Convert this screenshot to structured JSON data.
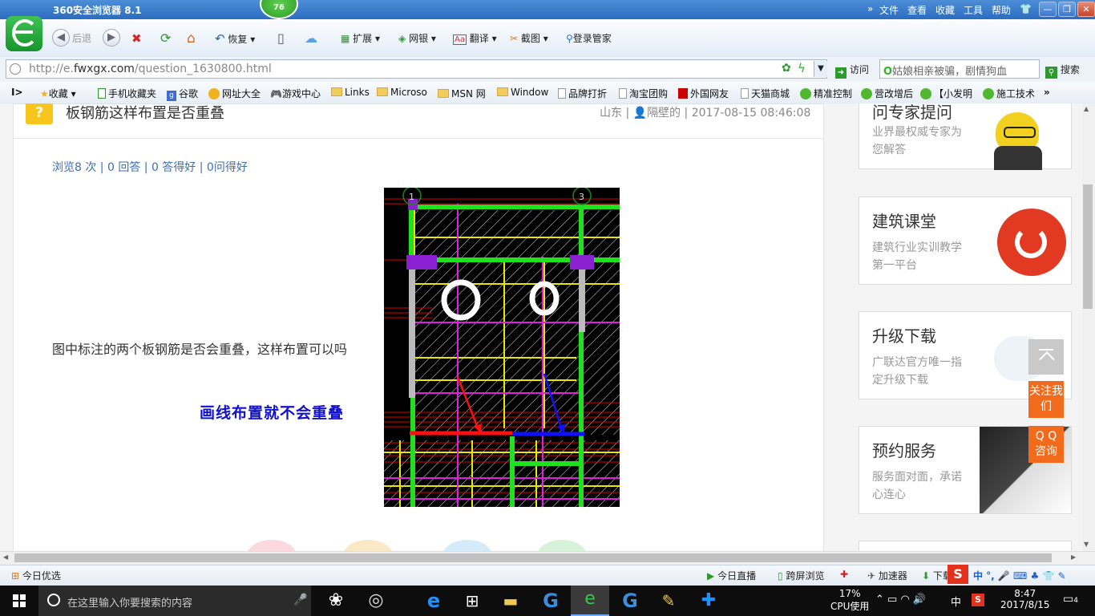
{
  "titlebar": {
    "app_title": "360安全浏览器 8.1",
    "badge": "76",
    "menu": [
      "文件",
      "查看",
      "收藏",
      "工具",
      "帮助"
    ]
  },
  "toolbar": {
    "back": "后退",
    "restore": "恢复",
    "extend": "扩展",
    "bank": "网银",
    "translate": "翻译",
    "screenshot": "截图",
    "login_manager": "登录管家"
  },
  "address": {
    "url_prefix": "http://e.",
    "url_domain": "fwxgx.com",
    "url_path": "/question_1630800.html",
    "visit": "访问",
    "search_placeholder": "姑娘相亲被骗，剧情狗血",
    "search_button": "搜索"
  },
  "favorites": [
    "收藏",
    "手机收藏夹",
    "谷歌",
    "网址大全",
    "游戏中心",
    "Links",
    "Microso",
    "MSN 网",
    "Window",
    "品牌打折",
    "淘宝团购",
    "外国网友",
    "天猫商城",
    "精准控制",
    "营改增后",
    "【小发明",
    "施工技术"
  ],
  "question": {
    "icon": "?",
    "title": "板钢筋这样布置是否重叠",
    "location": "山东",
    "user": "隔壁的",
    "datetime": "2017-08-15 08:46:08",
    "stats": "浏览8 次 | 0 回答 | 0 答得好 | 0问得好",
    "text": "图中标注的两个板钢筋是否会重叠，这样布置可以吗",
    "annotation": "画线布置就不会重叠"
  },
  "sidebar": {
    "cards": [
      {
        "title": "问专家提问",
        "desc": "业界最权威专家为您解答"
      },
      {
        "title": "建筑课堂",
        "desc": "建筑行业实训教学第一平台"
      },
      {
        "title": "升级下载",
        "desc": "广联达官方唯一指定升级下载"
      },
      {
        "title": "预约服务",
        "desc": "服务面对面，承诺心连心"
      }
    ],
    "follow": "关注我们",
    "qq": "Q Q 咨询"
  },
  "statusbar": {
    "today_pick": "今日优选",
    "today_live": "今日直播",
    "cross_screen": "跨屏浏览",
    "accelerator": "加速器",
    "download": "下载"
  },
  "taskbar": {
    "search_placeholder": "在这里输入你要搜索的内容",
    "cpu_percent": "17%",
    "cpu_label": "CPU使用",
    "ime": "中",
    "time": "8:47",
    "date": "2017/8/15",
    "notifications": "4"
  }
}
